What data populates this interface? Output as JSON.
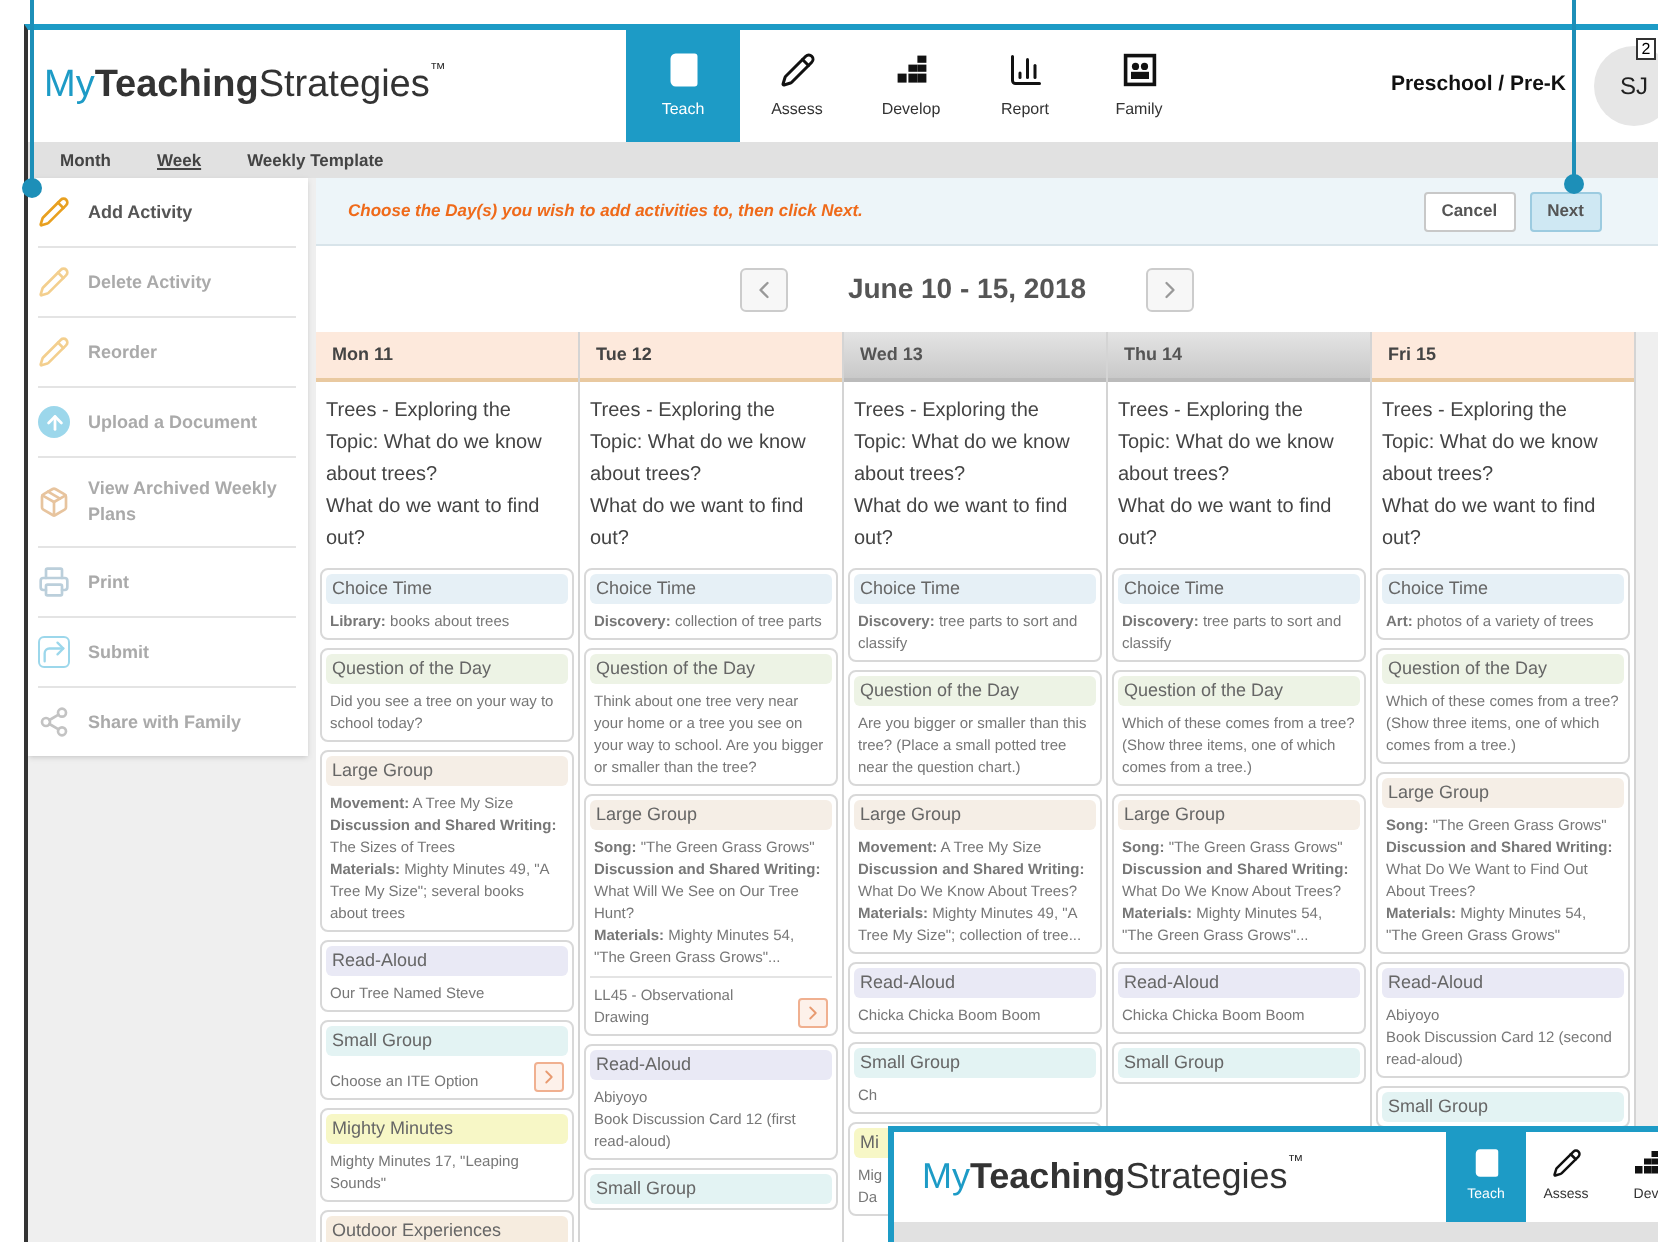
{
  "header": {
    "logo": {
      "prefix": "My",
      "bold": "Teaching",
      "suffix": "Strategies",
      "mark": "™"
    },
    "nav": [
      {
        "label": "Teach",
        "selected": true
      },
      {
        "label": "Assess",
        "selected": false
      },
      {
        "label": "Develop",
        "selected": false
      },
      {
        "label": "Report",
        "selected": false
      },
      {
        "label": "Family",
        "selected": false
      }
    ],
    "program": "Preschool / Pre-K",
    "avatar": "SJ",
    "badge": "2"
  },
  "subnav": [
    {
      "label": "Month",
      "selected": false
    },
    {
      "label": "Week",
      "selected": true
    },
    {
      "label": "Weekly Template",
      "selected": false
    }
  ],
  "sidebar": {
    "items": [
      {
        "label": "Add Activity",
        "disabled": false
      },
      {
        "label": "Delete Activity",
        "disabled": true
      },
      {
        "label": "Reorder",
        "disabled": true
      },
      {
        "label": "Upload a Document",
        "disabled": true
      },
      {
        "label": "View Archived Weekly Plans",
        "disabled": true
      },
      {
        "label": "Print",
        "disabled": true
      },
      {
        "label": "Submit",
        "disabled": true
      },
      {
        "label": "Share with Family",
        "disabled": true
      }
    ]
  },
  "instruction": "Choose the Day(s) you wish to add activities to, then click Next.",
  "buttons": [
    {
      "label": "Cancel",
      "highlighted": false
    },
    {
      "label": "Next",
      "highlighted": true
    }
  ],
  "week": "June 10 - 15, 2018",
  "days": [
    {
      "label": "Mon 11",
      "selected": true,
      "topic": [
        "Trees - Exploring the Topic: What do we know about trees?",
        "What do we want to find out?"
      ],
      "cards": [
        {
          "kind": "choice",
          "title": "Choice Time",
          "lines": [
            "**Library:** books about trees"
          ]
        },
        {
          "kind": "question",
          "title": "Question of the Day",
          "lines": [
            "Did you see a tree on your way to school today?"
          ]
        },
        {
          "kind": "large",
          "title": "Large Group",
          "lines": [
            "**Movement:** A Tree My Size",
            "**Discussion and Shared Writing:** The Sizes of Trees",
            "**Materials:** Mighty Minutes 49, \"A Tree My Size\"; several books about trees"
          ]
        },
        {
          "kind": "read",
          "title": "Read-Aloud",
          "lines": [
            "Our Tree Named Steve"
          ]
        },
        {
          "kind": "small",
          "title": "Small Group",
          "lines": [
            "Choose an ITE Option"
          ],
          "arrow": true
        },
        {
          "kind": "mighty",
          "title": "Mighty Minutes",
          "lines": [
            "Mighty Minutes 17, \"Leaping Sounds\""
          ]
        },
        {
          "kind": "outdoor",
          "title": "Outdoor Experiences"
        }
      ]
    },
    {
      "label": "Tue 12",
      "selected": true,
      "topic": [
        "Trees - Exploring the Topic: What do we know about trees?",
        "What do we want to find out?"
      ],
      "cards": [
        {
          "kind": "choice",
          "title": "Choice Time",
          "lines": [
            "**Discovery:** collection of tree parts"
          ]
        },
        {
          "kind": "question",
          "title": "Question of the Day",
          "lines": [
            "Think about one tree very near your home or a tree you see on your way to school. Are you bigger or smaller than the tree?"
          ]
        },
        {
          "kind": "large",
          "title": "Large Group",
          "lines": [
            "**Song:** \"The Green Grass Grows\"",
            "**Discussion and Shared Writing:** What Will We See on Our Tree Hunt?",
            "**Materials:** Mighty Minutes 54, \"The Green Grass Grows\"..."
          ],
          "extra": "LL45 - Observational Drawing",
          "arrow": true
        },
        {
          "kind": "read",
          "title": "Read-Aloud",
          "lines": [
            "Abiyoyo",
            "Book Discussion Card 12 (first read-aloud)"
          ]
        },
        {
          "kind": "small",
          "title": "Small Group"
        }
      ]
    },
    {
      "label": "Wed 13",
      "selected": false,
      "topic": [
        "Trees - Exploring the Topic: What do we know about trees?",
        "What do we want to find out?"
      ],
      "cards": [
        {
          "kind": "choice",
          "title": "Choice Time",
          "lines": [
            "**Discovery:** tree parts to sort and classify"
          ]
        },
        {
          "kind": "question",
          "title": "Question of the Day",
          "lines": [
            "Are you bigger or smaller than this tree? (Place a small potted tree near the question chart.)"
          ]
        },
        {
          "kind": "large",
          "title": "Large Group",
          "lines": [
            "**Movement:** A Tree My Size",
            "**Discussion and Shared Writing:** What Do We Know About Trees?",
            "**Materials:** Mighty Minutes 49, \"A Tree My Size\"; collection of tree..."
          ]
        },
        {
          "kind": "read",
          "title": "Read-Aloud",
          "lines": [
            "Chicka Chicka Boom Boom"
          ]
        },
        {
          "kind": "small",
          "title": "Small Group",
          "lines": [
            "Ch"
          ]
        },
        {
          "kind": "mighty",
          "title": "Mi",
          "lines": [
            "Mig",
            "Da"
          ]
        }
      ]
    },
    {
      "label": "Thu 14",
      "selected": false,
      "topic": [
        "Trees - Exploring the Topic: What do we know about trees?",
        "What do we want to find out?"
      ],
      "cards": [
        {
          "kind": "choice",
          "title": "Choice Time",
          "lines": [
            "**Discovery:** tree parts to sort and classify"
          ]
        },
        {
          "kind": "question",
          "title": "Question of the Day",
          "lines": [
            "Which of these comes from a tree? (Show three items, one of which comes from a tree.)"
          ]
        },
        {
          "kind": "large",
          "title": "Large Group",
          "lines": [
            "**Song:** \"The Green Grass Grows\"",
            "**Discussion and Shared Writing:** What Do We Know About Trees?",
            "**Materials:** Mighty Minutes 54, \"The Green Grass Grows\"..."
          ]
        },
        {
          "kind": "read",
          "title": "Read-Aloud",
          "lines": [
            "Chicka Chicka Boom Boom"
          ]
        },
        {
          "kind": "small",
          "title": "Small Group"
        }
      ]
    },
    {
      "label": "Fri 15",
      "selected": true,
      "topic": [
        "Trees - Exploring the Topic: What do we know about trees?",
        "What do we want to find out?"
      ],
      "cards": [
        {
          "kind": "choice",
          "title": "Choice Time",
          "lines": [
            "**Art:** photos of a variety of trees"
          ]
        },
        {
          "kind": "question",
          "title": "Question of the Day",
          "lines": [
            "Which of these comes from a tree? (Show three items, one of which comes from a tree.)"
          ]
        },
        {
          "kind": "large",
          "title": "Large Group",
          "lines": [
            "**Song:** \"The Green Grass Grows\"",
            "**Discussion and Shared Writing:** What Do We Want to Find Out About Trees?",
            "**Materials:** Mighty Minutes 54, \"The Green Grass Grows\""
          ]
        },
        {
          "kind": "read",
          "title": "Read-Aloud",
          "lines": [
            "Abiyoyo",
            "Book Discussion Card 12 (second read-aloud)"
          ]
        },
        {
          "kind": "small",
          "title": "Small Group"
        }
      ]
    }
  ],
  "overlay": {
    "logo": {
      "prefix": "My",
      "bold": "Teaching",
      "suffix": "Strategies",
      "mark": "™"
    },
    "nav": [
      {
        "label": "Teach",
        "selected": true
      },
      {
        "label": "Assess",
        "selected": false
      },
      {
        "label": "Dev",
        "selected": false
      }
    ]
  }
}
